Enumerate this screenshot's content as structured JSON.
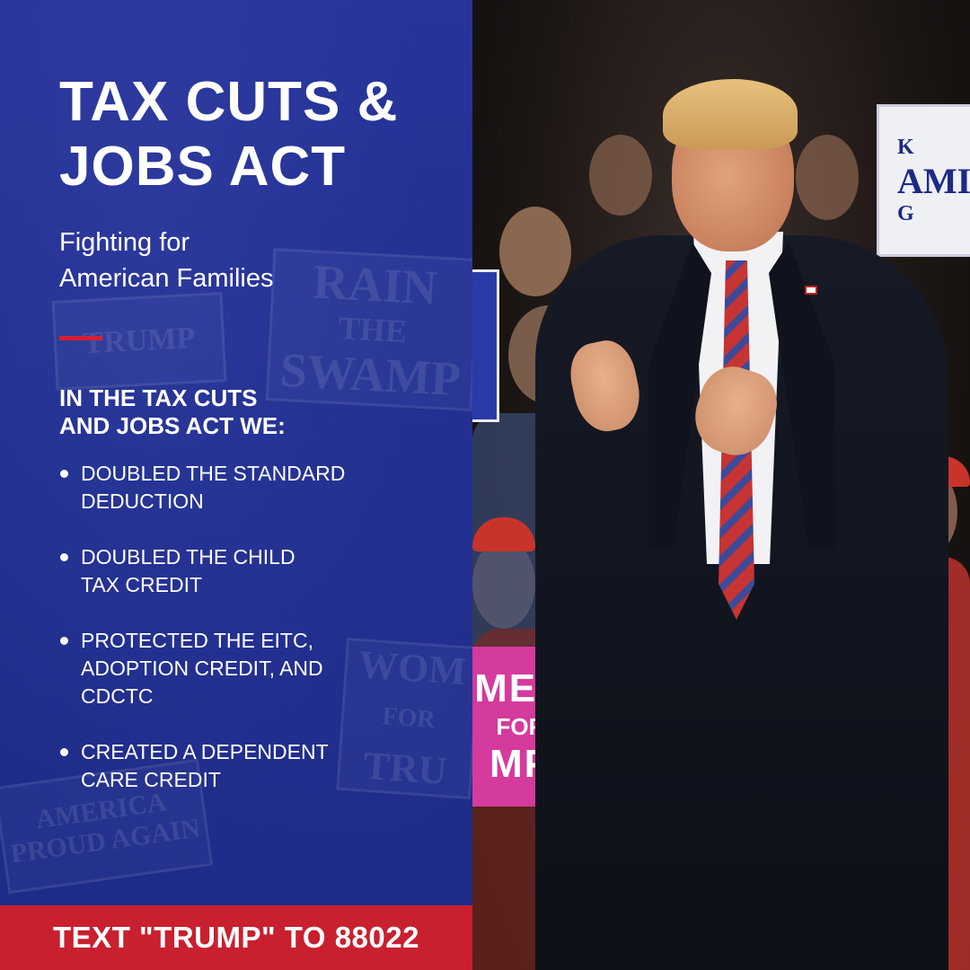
{
  "headline": {
    "title_line1": "TAX CUTS &",
    "title_line2": "JOBS ACT",
    "subtitle_line1": "Fighting for",
    "subtitle_line2": "American Families"
  },
  "list": {
    "heading_line1": "IN THE TAX CUTS",
    "heading_line2": "AND JOBS ACT WE:",
    "items": [
      {
        "line1": "DOUBLED THE STANDARD",
        "line2": "DEDUCTION",
        "line3": ""
      },
      {
        "line1": "DOUBLED THE CHILD",
        "line2": "TAX CREDIT",
        "line3": ""
      },
      {
        "line1": "PROTECTED THE EITC,",
        "line2": "ADOPTION CREDIT, AND",
        "line3": "CDCTC"
      },
      {
        "line1": "CREATED A DEPENDENT",
        "line2": "CARE CREDIT",
        "line3": ""
      }
    ]
  },
  "cta": {
    "label": "TEXT \"TRUMP\" TO 88022"
  },
  "background_signs": {
    "sign1_line1": "RAIN",
    "sign1_line2": "THE",
    "sign1_line3": "SWAMP",
    "sign2": "TRUMP",
    "sign3_line1": "AMERICA",
    "sign3_line2": "PROUD AGAIN",
    "sign4_line1": "WOM",
    "sign4_line2": "FOR",
    "sign4_line3": "TRU"
  },
  "photo_signs": {
    "white_line1": "K",
    "white_line2": "AMI",
    "white_line3": "G",
    "pink_line1": "MEN",
    "pink_line2": "FOR",
    "pink_line3": "MP"
  },
  "colors": {
    "panel_blue": "#213090",
    "accent_red": "#d42033",
    "cta_red": "#c8202f",
    "text_white": "#ffffff",
    "sign_pink": "#d53a9d"
  },
  "icons": {
    "bullet": "bullet-dot-icon",
    "divider": "red-divider"
  }
}
